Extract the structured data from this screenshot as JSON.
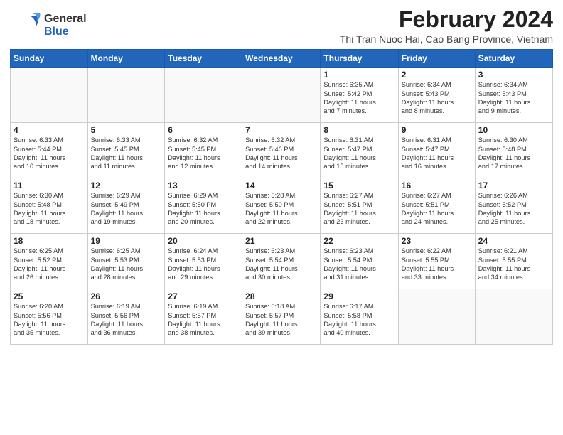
{
  "logo": {
    "line1": "General",
    "line2": "Blue"
  },
  "title": "February 2024",
  "location": "Thi Tran Nuoc Hai, Cao Bang Province, Vietnam",
  "days_of_week": [
    "Sunday",
    "Monday",
    "Tuesday",
    "Wednesday",
    "Thursday",
    "Friday",
    "Saturday"
  ],
  "weeks": [
    [
      {
        "day": "",
        "info": ""
      },
      {
        "day": "",
        "info": ""
      },
      {
        "day": "",
        "info": ""
      },
      {
        "day": "",
        "info": ""
      },
      {
        "day": "1",
        "info": "Sunrise: 6:35 AM\nSunset: 5:42 PM\nDaylight: 11 hours\nand 7 minutes."
      },
      {
        "day": "2",
        "info": "Sunrise: 6:34 AM\nSunset: 5:43 PM\nDaylight: 11 hours\nand 8 minutes."
      },
      {
        "day": "3",
        "info": "Sunrise: 6:34 AM\nSunset: 5:43 PM\nDaylight: 11 hours\nand 9 minutes."
      }
    ],
    [
      {
        "day": "4",
        "info": "Sunrise: 6:33 AM\nSunset: 5:44 PM\nDaylight: 11 hours\nand 10 minutes."
      },
      {
        "day": "5",
        "info": "Sunrise: 6:33 AM\nSunset: 5:45 PM\nDaylight: 11 hours\nand 11 minutes."
      },
      {
        "day": "6",
        "info": "Sunrise: 6:32 AM\nSunset: 5:45 PM\nDaylight: 11 hours\nand 12 minutes."
      },
      {
        "day": "7",
        "info": "Sunrise: 6:32 AM\nSunset: 5:46 PM\nDaylight: 11 hours\nand 14 minutes."
      },
      {
        "day": "8",
        "info": "Sunrise: 6:31 AM\nSunset: 5:47 PM\nDaylight: 11 hours\nand 15 minutes."
      },
      {
        "day": "9",
        "info": "Sunrise: 6:31 AM\nSunset: 5:47 PM\nDaylight: 11 hours\nand 16 minutes."
      },
      {
        "day": "10",
        "info": "Sunrise: 6:30 AM\nSunset: 5:48 PM\nDaylight: 11 hours\nand 17 minutes."
      }
    ],
    [
      {
        "day": "11",
        "info": "Sunrise: 6:30 AM\nSunset: 5:48 PM\nDaylight: 11 hours\nand 18 minutes."
      },
      {
        "day": "12",
        "info": "Sunrise: 6:29 AM\nSunset: 5:49 PM\nDaylight: 11 hours\nand 19 minutes."
      },
      {
        "day": "13",
        "info": "Sunrise: 6:29 AM\nSunset: 5:50 PM\nDaylight: 11 hours\nand 20 minutes."
      },
      {
        "day": "14",
        "info": "Sunrise: 6:28 AM\nSunset: 5:50 PM\nDaylight: 11 hours\nand 22 minutes."
      },
      {
        "day": "15",
        "info": "Sunrise: 6:27 AM\nSunset: 5:51 PM\nDaylight: 11 hours\nand 23 minutes."
      },
      {
        "day": "16",
        "info": "Sunrise: 6:27 AM\nSunset: 5:51 PM\nDaylight: 11 hours\nand 24 minutes."
      },
      {
        "day": "17",
        "info": "Sunrise: 6:26 AM\nSunset: 5:52 PM\nDaylight: 11 hours\nand 25 minutes."
      }
    ],
    [
      {
        "day": "18",
        "info": "Sunrise: 6:25 AM\nSunset: 5:52 PM\nDaylight: 11 hours\nand 26 minutes."
      },
      {
        "day": "19",
        "info": "Sunrise: 6:25 AM\nSunset: 5:53 PM\nDaylight: 11 hours\nand 28 minutes."
      },
      {
        "day": "20",
        "info": "Sunrise: 6:24 AM\nSunset: 5:53 PM\nDaylight: 11 hours\nand 29 minutes."
      },
      {
        "day": "21",
        "info": "Sunrise: 6:23 AM\nSunset: 5:54 PM\nDaylight: 11 hours\nand 30 minutes."
      },
      {
        "day": "22",
        "info": "Sunrise: 6:23 AM\nSunset: 5:54 PM\nDaylight: 11 hours\nand 31 minutes."
      },
      {
        "day": "23",
        "info": "Sunrise: 6:22 AM\nSunset: 5:55 PM\nDaylight: 11 hours\nand 33 minutes."
      },
      {
        "day": "24",
        "info": "Sunrise: 6:21 AM\nSunset: 5:55 PM\nDaylight: 11 hours\nand 34 minutes."
      }
    ],
    [
      {
        "day": "25",
        "info": "Sunrise: 6:20 AM\nSunset: 5:56 PM\nDaylight: 11 hours\nand 35 minutes."
      },
      {
        "day": "26",
        "info": "Sunrise: 6:19 AM\nSunset: 5:56 PM\nDaylight: 11 hours\nand 36 minutes."
      },
      {
        "day": "27",
        "info": "Sunrise: 6:19 AM\nSunset: 5:57 PM\nDaylight: 11 hours\nand 38 minutes."
      },
      {
        "day": "28",
        "info": "Sunrise: 6:18 AM\nSunset: 5:57 PM\nDaylight: 11 hours\nand 39 minutes."
      },
      {
        "day": "29",
        "info": "Sunrise: 6:17 AM\nSunset: 5:58 PM\nDaylight: 11 hours\nand 40 minutes."
      },
      {
        "day": "",
        "info": ""
      },
      {
        "day": "",
        "info": ""
      }
    ]
  ]
}
